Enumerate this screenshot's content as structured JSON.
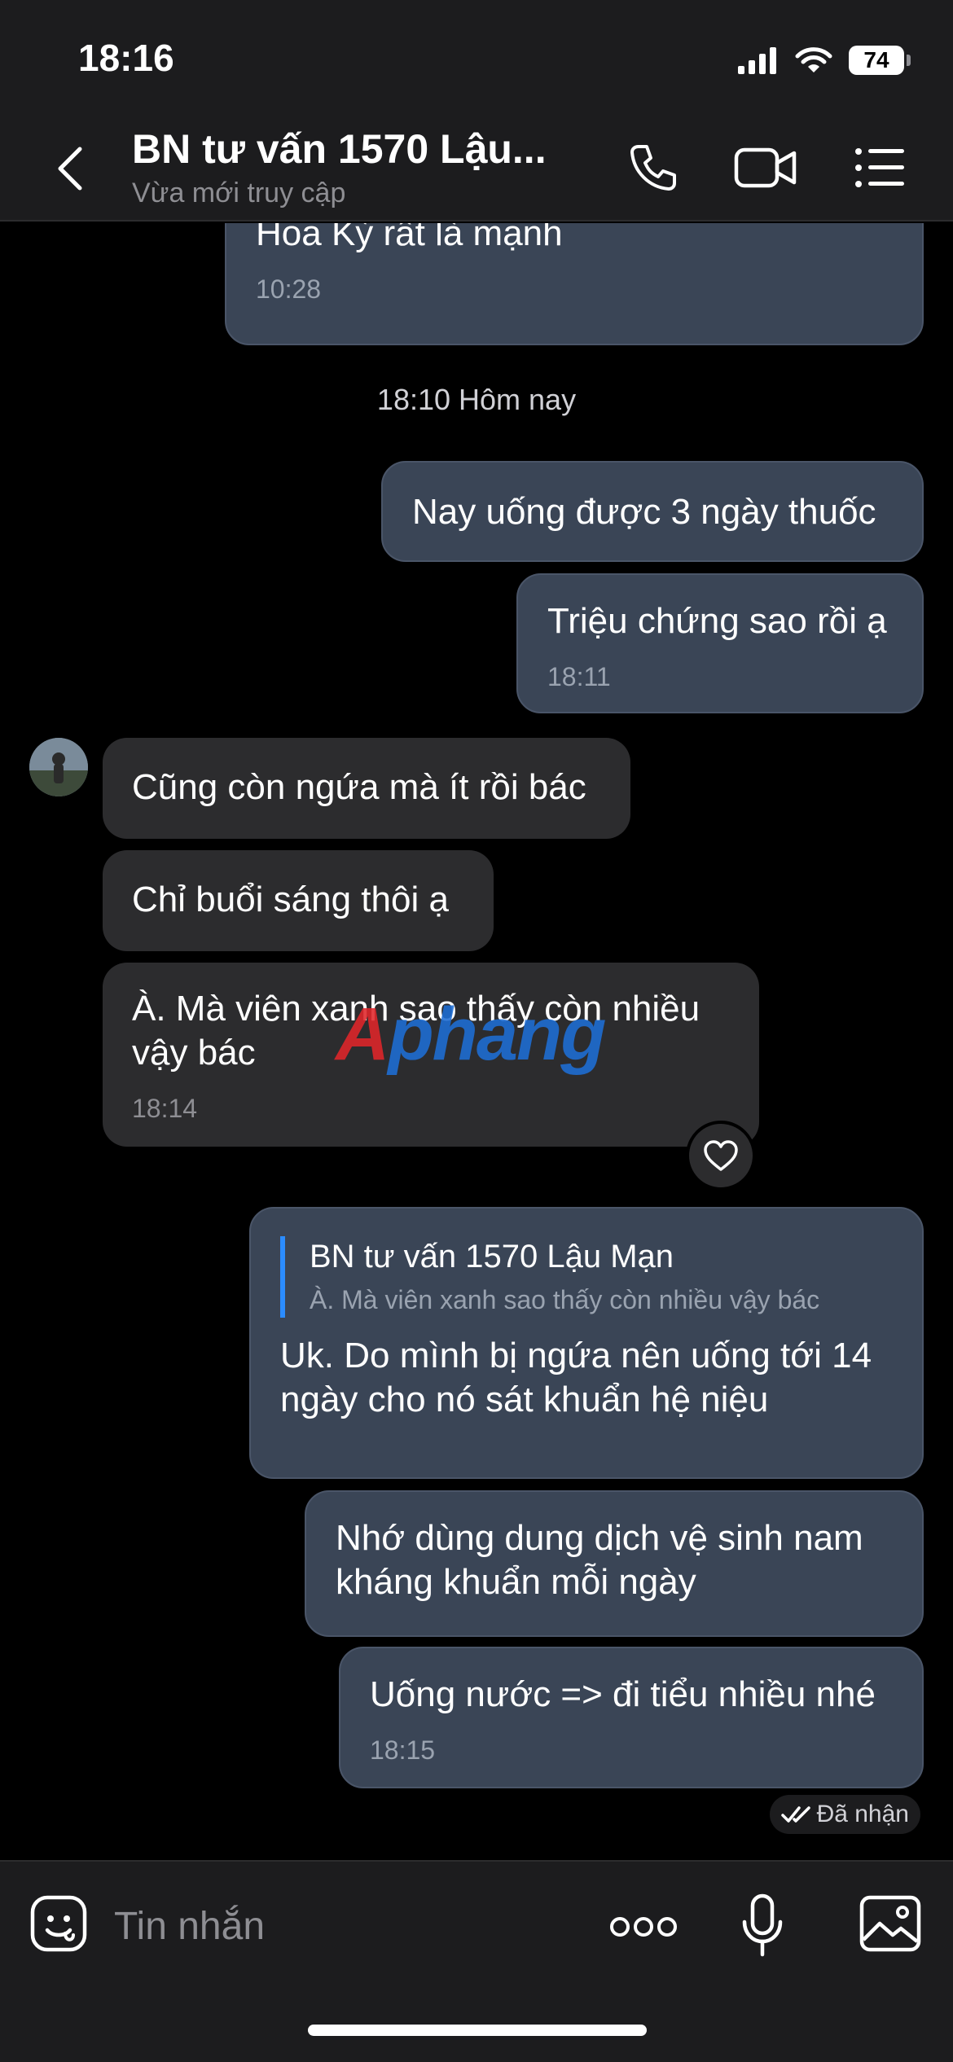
{
  "status_bar": {
    "time": "18:16",
    "battery": "74"
  },
  "header": {
    "title": "BN tư vấn 1570 Lậu...",
    "subtitle": "Vừa mới truy cập",
    "icons": [
      "back-icon",
      "phone-icon",
      "video-icon",
      "list-icon"
    ]
  },
  "messages": {
    "m0": {
      "text": "Cố gắng. Điều trị theo phác đồ CDC\nHoa Kỳ rất là mạnh",
      "time": "10:28"
    },
    "date_separator": "18:10 Hôm nay",
    "m1": {
      "text": "Nay uống được 3 ngày thuốc"
    },
    "m2": {
      "text": "Triệu chứng sao rồi ạ",
      "time": "18:11"
    },
    "m3": {
      "text": "Cũng còn ngứa mà ít rồi bác"
    },
    "m4": {
      "text": "Chỉ buổi sáng thôi ạ"
    },
    "m5": {
      "text": "À. Mà viên xanh sao thấy còn nhiều\nvậy bác",
      "time": "18:14"
    },
    "m6": {
      "quote_name": "BN tư vấn 1570 Lậu Mạn",
      "quote_text": "À. Mà viên xanh sao thấy còn nhiều vậy bác",
      "text": "Uk. Do mình bị ngứa nên uống tới 14\nngày cho nó sát khuẩn hệ niệu"
    },
    "m7": {
      "text": "Nhớ dùng dung dịch vệ sinh nam\nkháng khuẩn mỗi ngày"
    },
    "m8": {
      "text": "Uống nước => đi tiểu nhiều nhé",
      "time": "18:15"
    },
    "read_receipt": "Đã nhận"
  },
  "watermark": {
    "part1": "A",
    "part2": "phang"
  },
  "composer": {
    "placeholder": "Tin nhắn"
  },
  "colors": {
    "background": "#000000",
    "bar": "#1c1c1e",
    "outgoing_bubble": "#3a4556",
    "incoming_bubble": "#2c2c2e",
    "quote_accent": "#2b8cff"
  }
}
